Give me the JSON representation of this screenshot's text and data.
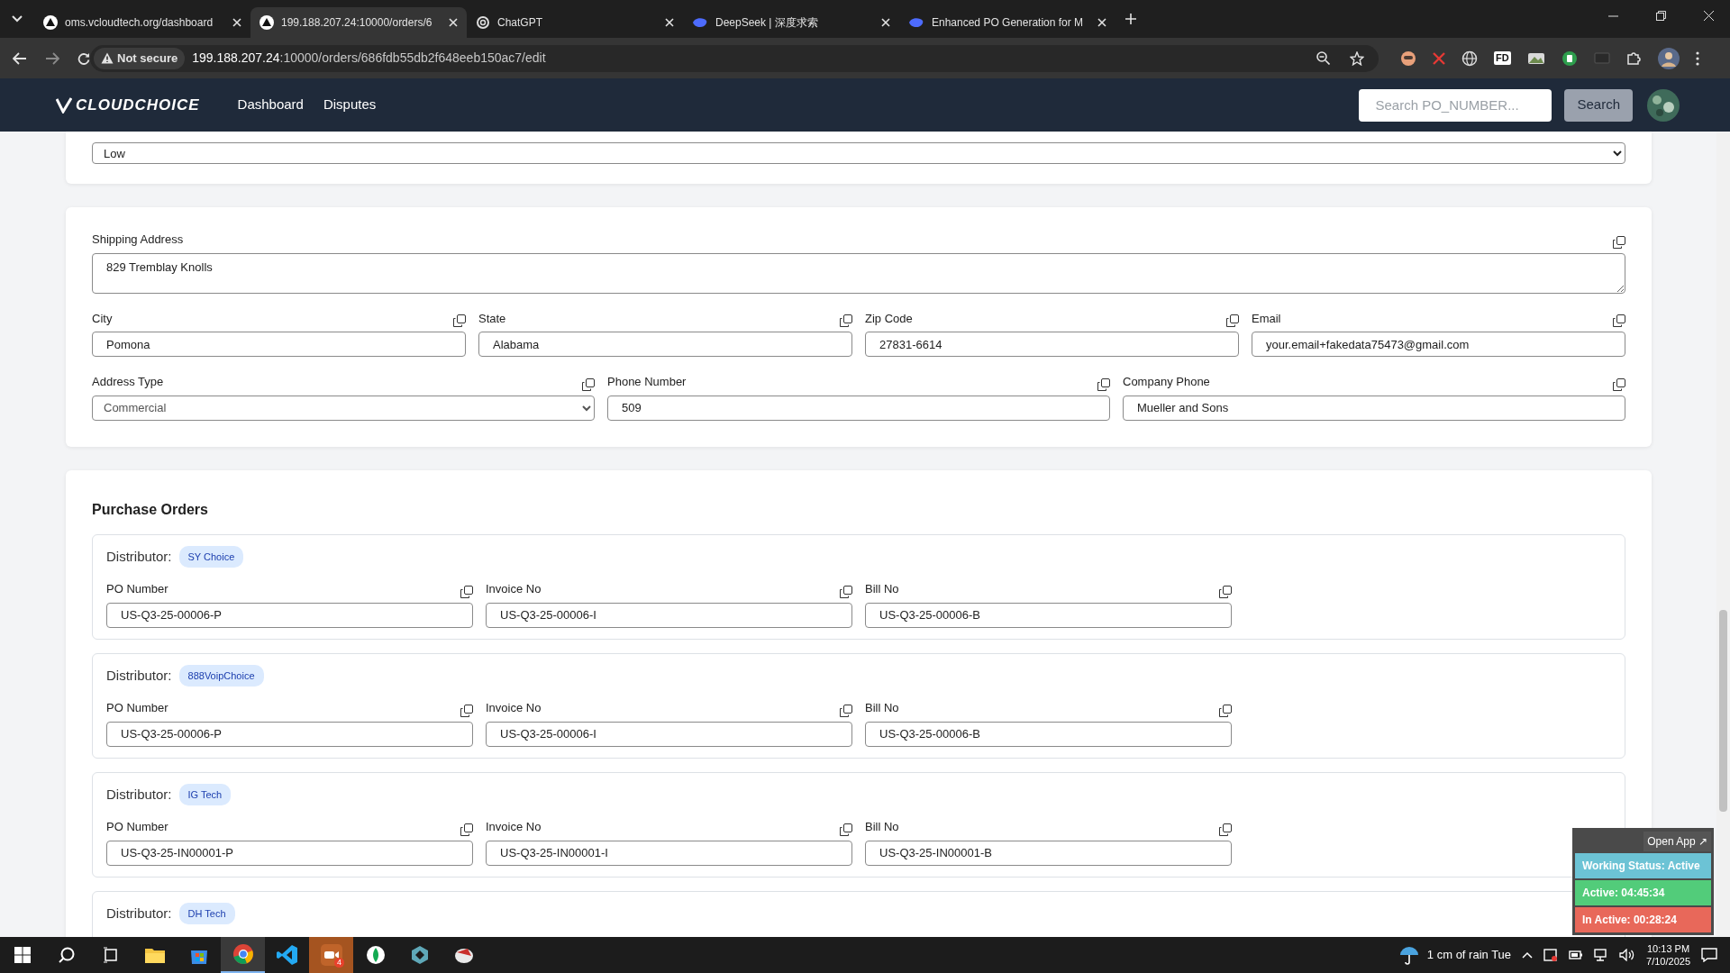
{
  "browser": {
    "tabs": [
      {
        "title": "oms.vcloudtech.org/dashboard",
        "kind": "site",
        "selected": false
      },
      {
        "title": "199.188.207.24:10000/orders/6",
        "kind": "site",
        "selected": true
      },
      {
        "title": "ChatGPT",
        "kind": "chatgpt",
        "selected": false
      },
      {
        "title": "DeepSeek | 深度求索",
        "kind": "deepseek",
        "selected": false
      },
      {
        "title": "Enhanced PO Generation for M",
        "kind": "deepseek",
        "selected": false
      }
    ],
    "security": "Not secure",
    "url_host": "199.188.207.24",
    "url_path": ":10000/orders/686fdb55db2f648eeb150ac7/edit",
    "extensions": [
      {
        "kind": "face"
      },
      {
        "kind": "cross"
      },
      {
        "kind": "globe"
      },
      {
        "kind": "text",
        "label": "FD"
      },
      {
        "kind": "image"
      },
      {
        "kind": "green"
      },
      {
        "kind": "dark"
      },
      {
        "kind": "puzzle"
      }
    ]
  },
  "navbar": {
    "brand": "CLOUDCHOICE",
    "links": [
      {
        "label": "Dashboard"
      },
      {
        "label": "Disputes"
      }
    ],
    "search": {
      "placeholder": "Search PO_NUMBER..."
    },
    "search_button": "Search"
  },
  "order_card": {
    "priority": {
      "value": "Low"
    }
  },
  "address_card": {
    "rows": [
      [
        {
          "label": "Shipping Address",
          "value": "829 Tremblay Knolls",
          "kind": "textarea"
        }
      ],
      [
        {
          "label": "City",
          "value": "Pomona",
          "kind": "input"
        },
        {
          "label": "State",
          "value": "Alabama",
          "kind": "input"
        },
        {
          "label": "Zip Code",
          "value": "27831-6614",
          "kind": "input"
        },
        {
          "label": "Email",
          "value": "your.email+fakedata75473@gmail.com",
          "kind": "input"
        }
      ],
      [
        {
          "label": "Address Type",
          "value": "Commercial",
          "kind": "select"
        },
        {
          "label": "Phone Number",
          "value": "509",
          "kind": "input"
        },
        {
          "label": "Company Phone",
          "value": "Mueller and Sons",
          "kind": "input"
        }
      ]
    ]
  },
  "purchase_orders": {
    "title": "Purchase Orders",
    "distributors": [
      {
        "label": "Distributor:",
        "name": "SY Choice",
        "fields": [
          {
            "label": "PO Number",
            "value": "US-Q3-25-00006-P"
          },
          {
            "label": "Invoice No",
            "value": "US-Q3-25-00006-I"
          },
          {
            "label": "Bill No",
            "value": "US-Q3-25-00006-B"
          }
        ]
      },
      {
        "label": "Distributor:",
        "name": "888VoipChoice",
        "fields": [
          {
            "label": "PO Number",
            "value": "US-Q3-25-00006-P"
          },
          {
            "label": "Invoice No",
            "value": "US-Q3-25-00006-I"
          },
          {
            "label": "Bill No",
            "value": "US-Q3-25-00006-B"
          }
        ]
      },
      {
        "label": "Distributor:",
        "name": "IG Tech",
        "fields": [
          {
            "label": "PO Number",
            "value": "US-Q3-25-IN00001-P"
          },
          {
            "label": "Invoice No",
            "value": "US-Q3-25-IN00001-I"
          },
          {
            "label": "Bill No",
            "value": "US-Q3-25-IN00001-B"
          }
        ]
      },
      {
        "label": "Distributor:",
        "name": "DH Tech"
      }
    ]
  },
  "status_widget": {
    "open_app": "Open App ↗",
    "items": [
      {
        "text": "Working Status: Active",
        "color": "#6cc3d5"
      },
      {
        "text": "Active: 04:45:34",
        "color": "#52cc7a"
      },
      {
        "text": "In Active: 00:28:24",
        "color": "#e8685a"
      }
    ]
  },
  "taskbar": {
    "apps": [
      {
        "kind": "explorer",
        "selected": false
      },
      {
        "kind": "store",
        "selected": false
      },
      {
        "kind": "chrome",
        "selected": true
      },
      {
        "kind": "vscode",
        "selected": false
      },
      {
        "kind": "zoom",
        "selected": false,
        "badge": "4"
      },
      {
        "kind": "leaf",
        "selected": false
      },
      {
        "kind": "cube",
        "selected": false
      },
      {
        "kind": "disk",
        "selected": false
      }
    ],
    "weather": "1 cm of rain Tue",
    "time": "10:13 PM",
    "date": "7/10/2025"
  }
}
